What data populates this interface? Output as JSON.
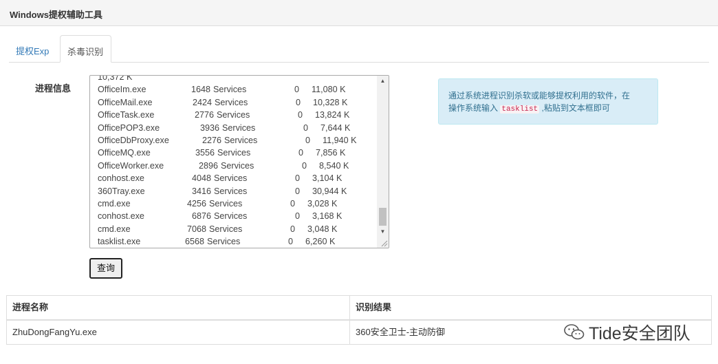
{
  "window": {
    "title": "Windows提权辅助工具"
  },
  "tabs": [
    {
      "label": "提权Exp",
      "active": false
    },
    {
      "label": "杀毒识别",
      "active": true
    }
  ],
  "form": {
    "process_label": "进程信息",
    "process_lines": [
      {
        "name": "10,372 K",
        "pid": "",
        "session": "",
        "num": "",
        "mem": ""
      },
      {
        "name": "OfficeIm.exe",
        "pid": "1648",
        "session": "Services",
        "num": "0",
        "mem": "11,080 K"
      },
      {
        "name": "OfficeMail.exe",
        "pid": "2424",
        "session": "Services",
        "num": "0",
        "mem": "10,328 K"
      },
      {
        "name": "OfficeTask.exe",
        "pid": "2776",
        "session": "Services",
        "num": "0",
        "mem": "13,824 K"
      },
      {
        "name": "OfficePOP3.exe",
        "pid": "3936",
        "session": "Services",
        "num": "0",
        "mem": "7,644 K"
      },
      {
        "name": "OfficeDbProxy.exe",
        "pid": "2276",
        "session": "Services",
        "num": "0",
        "mem": "11,940 K"
      },
      {
        "name": "OfficeMQ.exe",
        "pid": "3556",
        "session": "Services",
        "num": "0",
        "mem": "7,856 K"
      },
      {
        "name": "OfficeWorker.exe",
        "pid": "2896",
        "session": "Services",
        "num": "0",
        "mem": "8,540 K"
      },
      {
        "name": "conhost.exe",
        "pid": "4048",
        "session": "Services",
        "num": "0",
        "mem": "3,104 K"
      },
      {
        "name": "360Tray.exe",
        "pid": "3416",
        "session": "Services",
        "num": "0",
        "mem": "30,944 K"
      },
      {
        "name": "cmd.exe",
        "pid": "4256",
        "session": "Services",
        "num": "0",
        "mem": "3,028 K"
      },
      {
        "name": "conhost.exe",
        "pid": "6876",
        "session": "Services",
        "num": "0",
        "mem": "3,168 K"
      },
      {
        "name": "cmd.exe",
        "pid": "7068",
        "session": "Services",
        "num": "0",
        "mem": "3,048 K"
      },
      {
        "name": "tasklist.exe",
        "pid": "6568",
        "session": "Services",
        "num": "0",
        "mem": "6,260 K"
      }
    ],
    "query_button": "查询"
  },
  "alert": {
    "text_1": "通过系统进程识别杀软或能够提权利用的软件，在",
    "text_2a": "操作系统输入 ",
    "code": "tasklist",
    "text_2b": " ,粘贴到文本框即可"
  },
  "results": {
    "columns": [
      "进程名称",
      "识别结果"
    ],
    "rows": [
      [
        "ZhuDongFangYu.exe",
        "360安全卫士-主动防御"
      ]
    ]
  },
  "watermark": {
    "text": "Tide安全团队",
    "icon": "wechat-icon"
  }
}
